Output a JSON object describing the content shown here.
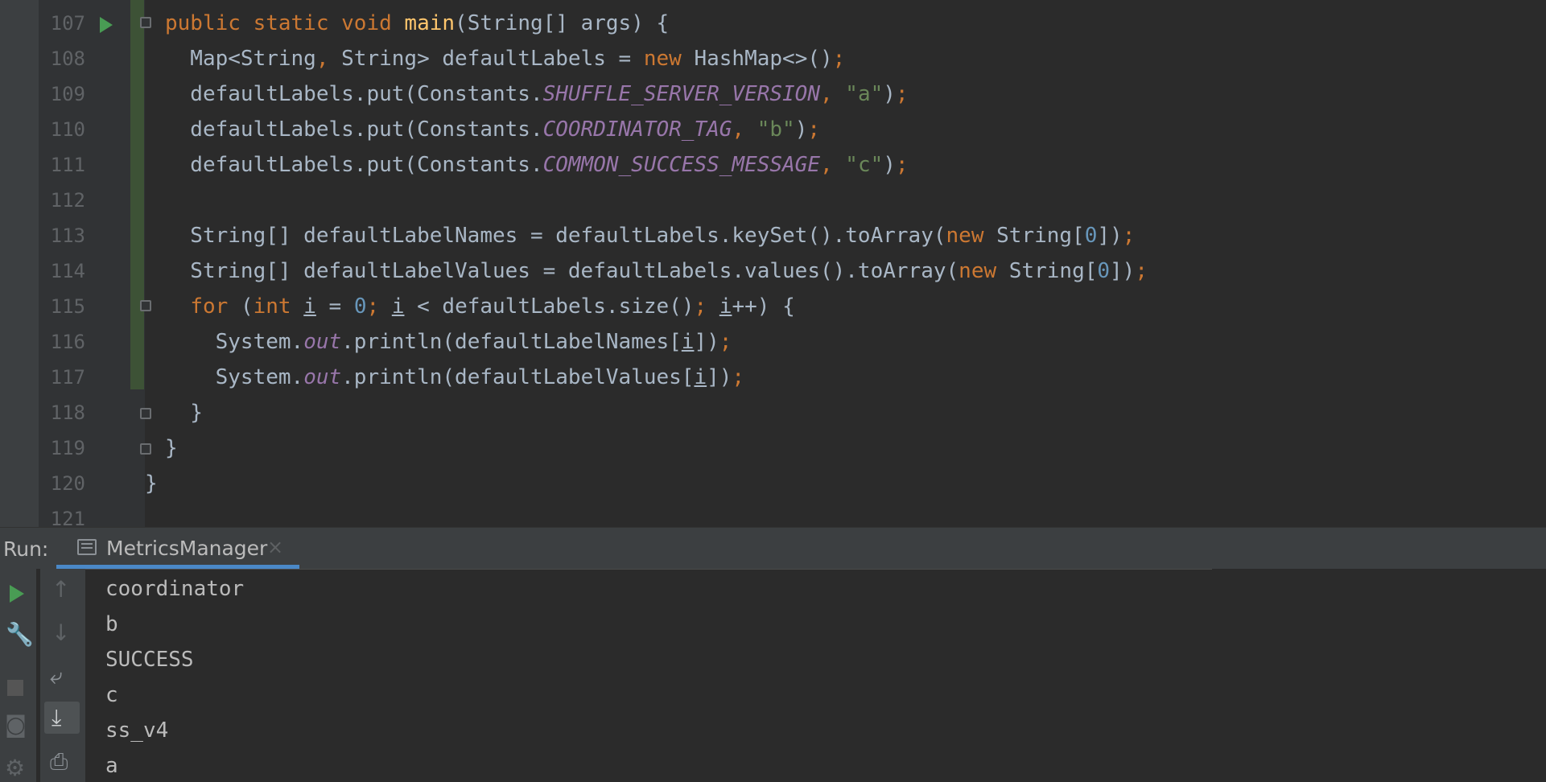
{
  "editor": {
    "lines": [
      {
        "num": "107",
        "html": "<span class=\"kw\">public static void </span><span class=\"fn\">main</span>(String[] args) {"
      },
      {
        "num": "108",
        "html": "  Map&lt;String<span class=\"kw\">, </span>String&gt; defaultLabels = <span class=\"kw\">new </span>HashMap&lt;&gt;()<span class=\"kw\">;</span>"
      },
      {
        "num": "109",
        "html": "  defaultLabels.put(Constants.<span class=\"st\">SHUFFLE_SERVER_VERSION</span><span class=\"kw\">, </span><span class=\"str\">\"a\"</span>)<span class=\"kw\">;</span>"
      },
      {
        "num": "110",
        "html": "  defaultLabels.put(Constants.<span class=\"st\">COORDINATOR_TAG</span><span class=\"kw\">, </span><span class=\"str\">\"b\"</span>)<span class=\"kw\">;</span>"
      },
      {
        "num": "111",
        "html": "  defaultLabels.put(Constants.<span class=\"st\">COMMON_SUCCESS_MESSAGE</span><span class=\"kw\">, </span><span class=\"str\">\"c\"</span>)<span class=\"kw\">;</span>"
      },
      {
        "num": "112",
        "html": ""
      },
      {
        "num": "113",
        "html": "  String[] defaultLabelNames = defaultLabels.keySet().toArray(<span class=\"kw\">new </span>String[<span class=\"num\">0</span>])<span class=\"kw\">;</span>"
      },
      {
        "num": "114",
        "html": "  String[] defaultLabelValues = defaultLabels.values().toArray(<span class=\"kw\">new </span>String[<span class=\"num\">0</span>])<span class=\"kw\">;</span>"
      },
      {
        "num": "115",
        "html": "  <span class=\"kw\">for </span>(<span class=\"kw\">int </span><span class=\"ul\">i</span> = <span class=\"num\">0</span><span class=\"kw\">; </span><span class=\"ul\">i</span> &lt; defaultLabels.size()<span class=\"kw\">; </span><span class=\"ul\">i</span>++) {"
      },
      {
        "num": "116",
        "html": "    System.<span class=\"st\">out</span>.println(defaultLabelNames[<span class=\"ul\">i</span>])<span class=\"kw\">;</span>"
      },
      {
        "num": "117",
        "html": "    System.<span class=\"st\">out</span>.println(defaultLabelValues[<span class=\"ul\">i</span>])<span class=\"kw\">;</span>"
      },
      {
        "num": "118",
        "html": "  }"
      },
      {
        "num": "119",
        "html": "}"
      },
      {
        "num": "120",
        "html": "}"
      },
      {
        "num": "121",
        "html": ""
      }
    ]
  },
  "run": {
    "label": "Run:",
    "tab_label": "MetricsManager",
    "tab_close": "×",
    "output": [
      "coordinator",
      "b",
      "SUCCESS",
      "c",
      "ss_v4",
      "a"
    ]
  },
  "icons": {
    "run_gutter": "run-icon",
    "rerun": "play-icon",
    "settings": "wrench-icon",
    "up": "arrow-up-icon",
    "down": "arrow-down-icon",
    "wrap": "soft-wrap-icon",
    "scroll_end": "scroll-to-end-icon",
    "print": "print-icon",
    "stop": "stop-icon",
    "snapshot": "camera-icon",
    "gear": "gear-icon"
  },
  "colors": {
    "keyword": "#cc7832",
    "method": "#ffc66d",
    "static_field": "#9876aa",
    "string": "#6a8759",
    "number": "#6897bb",
    "text": "#a9b7c6",
    "run_green": "#499c54",
    "tab_accent": "#4a88c7"
  }
}
